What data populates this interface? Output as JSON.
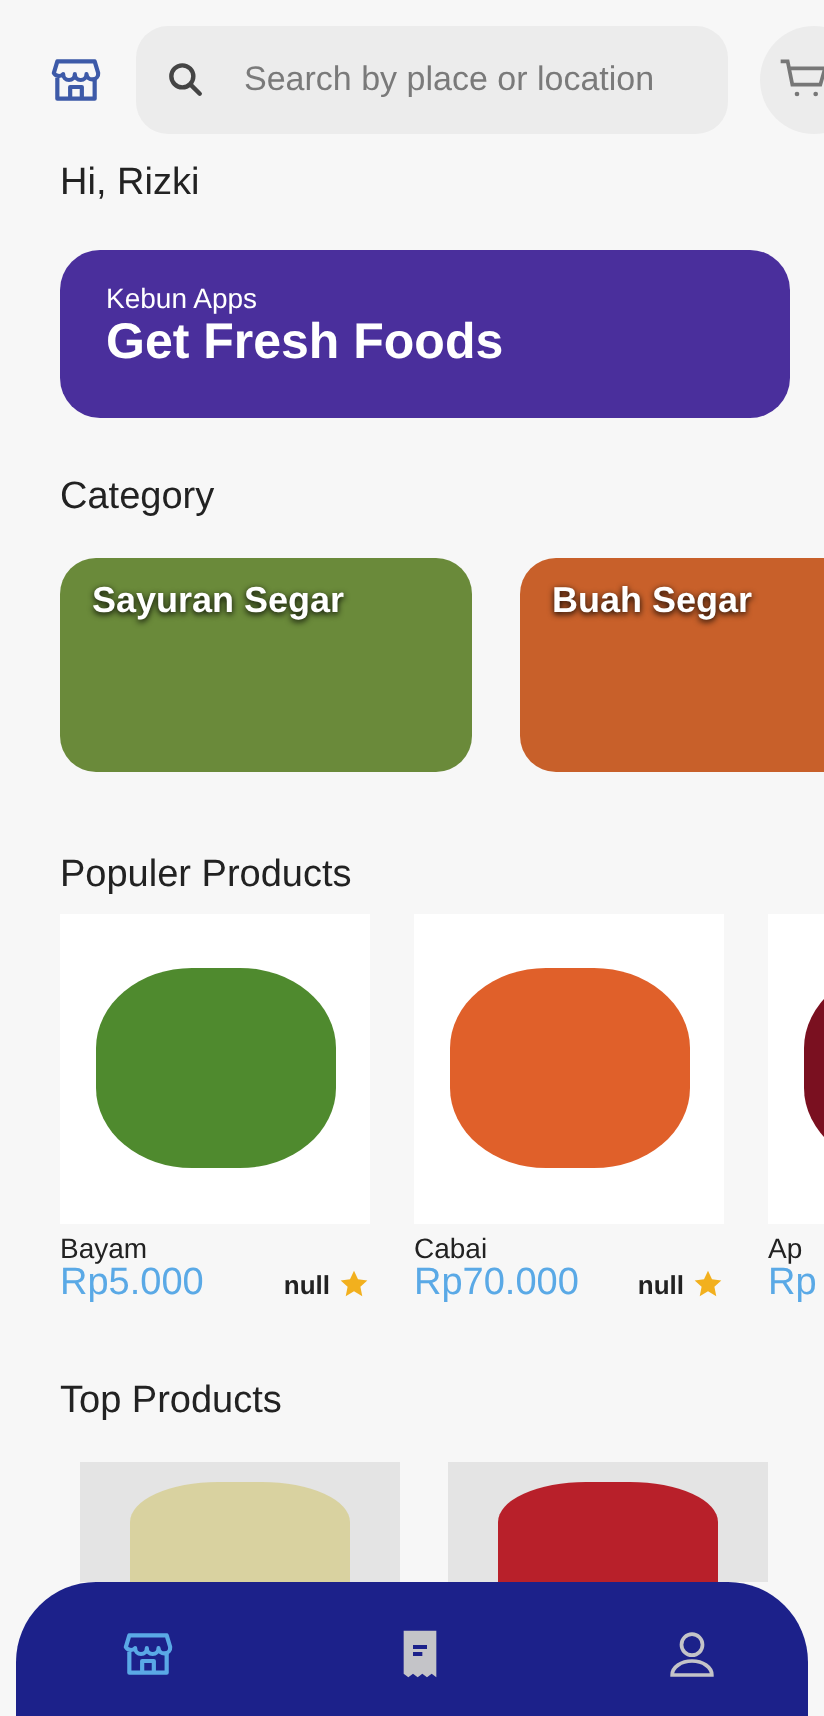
{
  "header": {
    "search": {
      "placeholder": "Search by place or location"
    }
  },
  "greeting": "Hi, Rizki",
  "banner": {
    "subtitle": "Kebun Apps",
    "title": "Get Fresh Foods"
  },
  "category": {
    "title": "Category",
    "items": [
      {
        "label": "Sayuran Segar",
        "color": "#6a8a3a"
      },
      {
        "label": "Buah Segar",
        "color": "#c8602a"
      }
    ]
  },
  "popular": {
    "title": "Populer Products",
    "items": [
      {
        "name": "Bayam",
        "price": "Rp5.000",
        "rating": "null",
        "color": "#4f8a2e"
      },
      {
        "name": "Cabai",
        "price": "Rp70.000",
        "rating": "null",
        "color": "#e0602a"
      },
      {
        "name": "Ap",
        "price": "Rp",
        "color": "#7a1020"
      }
    ]
  },
  "top": {
    "title": "Top Products",
    "items": [
      {
        "color": "#d9d2a0"
      },
      {
        "color": "#b8202a"
      }
    ]
  },
  "nav": [
    {
      "kind": "store",
      "selected": true
    },
    {
      "kind": "receipt",
      "selected": false
    },
    {
      "kind": "person",
      "selected": false
    }
  ]
}
